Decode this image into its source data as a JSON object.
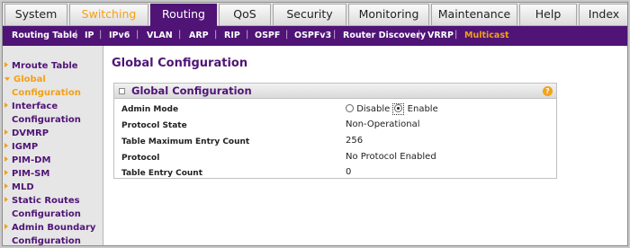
{
  "tabs": [
    {
      "label": "System"
    },
    {
      "label": "Switching"
    },
    {
      "label": "Routing"
    },
    {
      "label": "QoS"
    },
    {
      "label": "Security"
    },
    {
      "label": "Monitoring"
    },
    {
      "label": "Maintenance"
    },
    {
      "label": "Help"
    },
    {
      "label": "Index"
    }
  ],
  "active_tab": "Routing",
  "subnav": [
    {
      "label": "Routing Table"
    },
    {
      "label": "IP"
    },
    {
      "label": "IPv6"
    },
    {
      "label": "VLAN"
    },
    {
      "label": "ARP"
    },
    {
      "label": "RIP"
    },
    {
      "label": "OSPF"
    },
    {
      "label": "OSPFv3"
    },
    {
      "label": "Router Discovery"
    },
    {
      "label": "VRRP"
    },
    {
      "label": "Multicast"
    }
  ],
  "subnav_separator": "|",
  "sidebar": [
    {
      "label": "Mroute Table"
    },
    {
      "label": "Global"
    },
    {
      "label": "Configuration"
    },
    {
      "label": "Interface"
    },
    {
      "label": "Configuration"
    },
    {
      "label": "DVMRP"
    },
    {
      "label": "IGMP"
    },
    {
      "label": "PIM-DM"
    },
    {
      "label": "PIM-SM"
    },
    {
      "label": "MLD"
    },
    {
      "label": "Static Routes"
    },
    {
      "label": "Configuration"
    },
    {
      "label": "Admin Boundary"
    },
    {
      "label": "Configuration"
    }
  ],
  "page_title": "Global Configuration",
  "panel": {
    "title": "Global Configuration",
    "help_glyph": "?",
    "rows": [
      {
        "label": "Admin Mode"
      },
      {
        "label": "Protocol State",
        "value": "Non-Operational"
      },
      {
        "label": "Table Maximum Entry Count",
        "value": "256"
      },
      {
        "label": "Protocol",
        "value": "No Protocol Enabled"
      },
      {
        "label": "Table Entry Count",
        "value": "0"
      }
    ],
    "admin_mode": {
      "options": [
        "Disable",
        "Enable"
      ],
      "selected": "Enable"
    }
  },
  "colors": {
    "brand_purple": "#4f1476",
    "accent_orange": "#f5a012"
  }
}
